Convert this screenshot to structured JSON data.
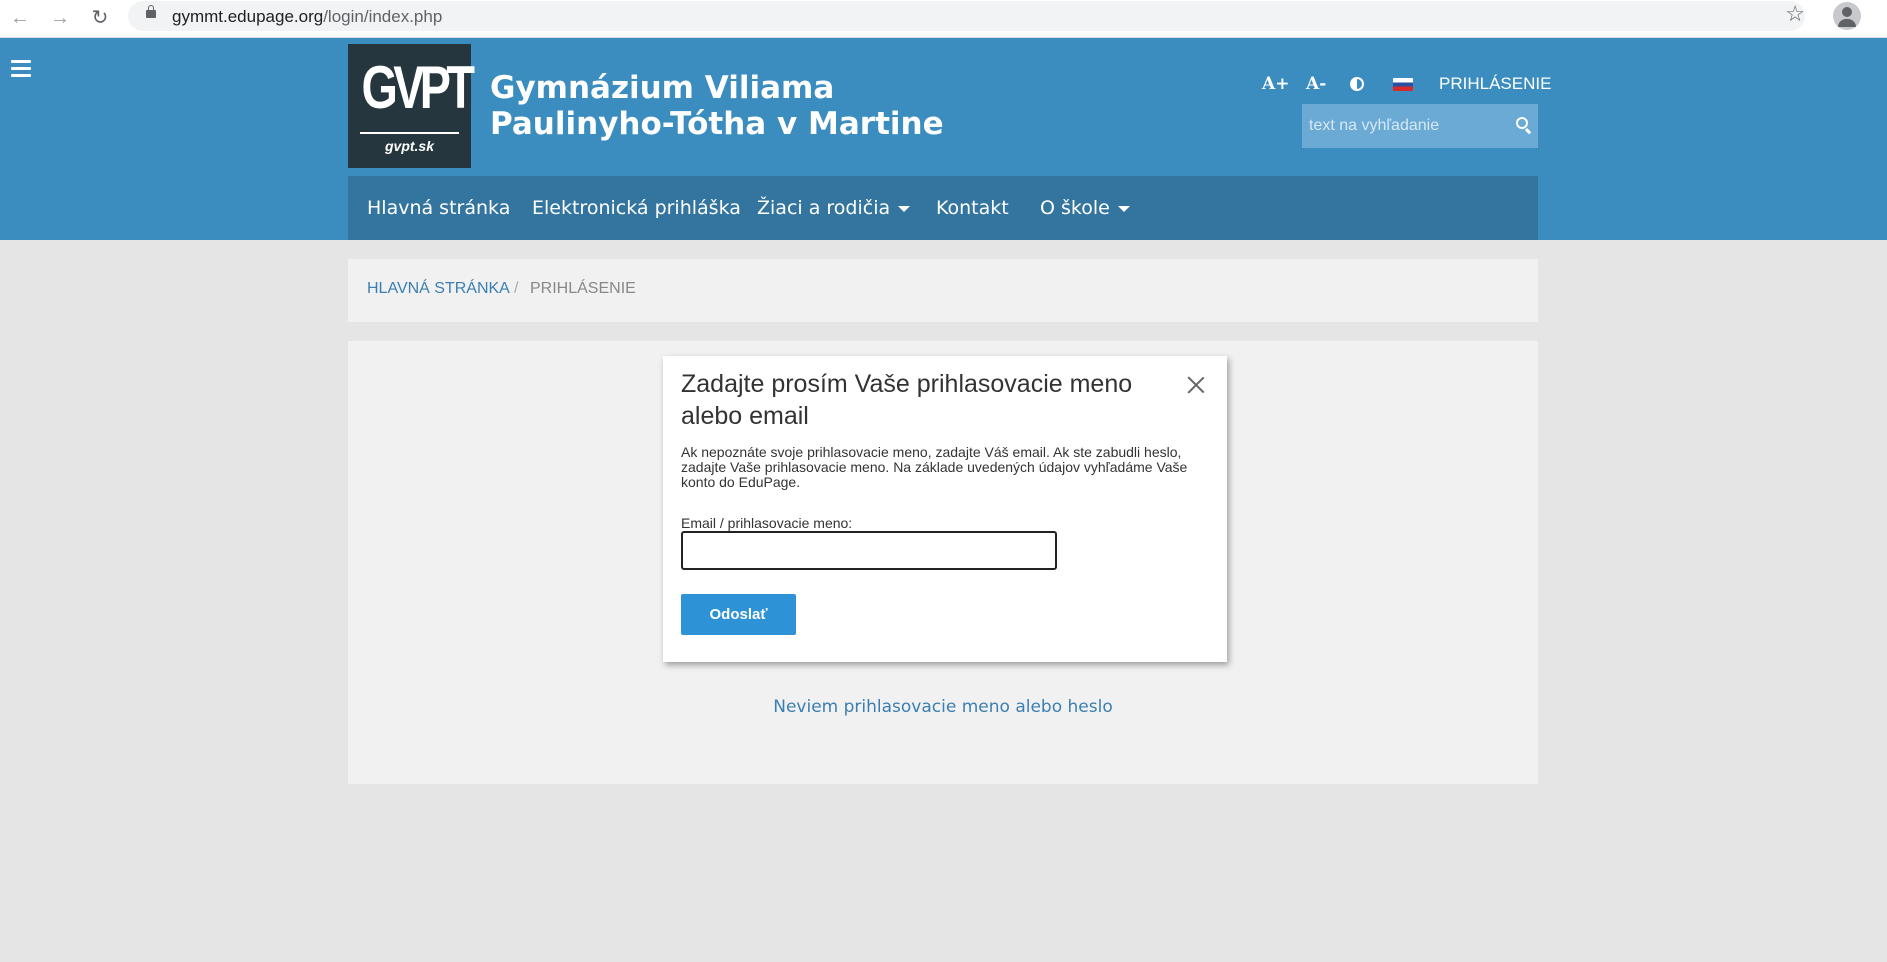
{
  "browser": {
    "url_host": "gymmt.edupage.org",
    "url_path": "/login/index.php"
  },
  "header": {
    "logo_text": "GVPT",
    "logo_subtext": "gvpt.sk",
    "school_name": "Gymnázium Viliama Paulinyho-Tótha v Martine",
    "font_increase_label": "A+",
    "font_decrease_label": "A-",
    "login_label": "PRIHLÁSENIE",
    "search_placeholder": "text na vyhľadanie"
  },
  "nav": {
    "items": [
      {
        "label": "Hlavná stránka",
        "dropdown": false
      },
      {
        "label": "Elektronická prihláška",
        "dropdown": false
      },
      {
        "label": "Žiaci a rodičia",
        "dropdown": true
      },
      {
        "label": "Kontakt",
        "dropdown": false
      },
      {
        "label": "O škole",
        "dropdown": true
      }
    ]
  },
  "breadcrumb": {
    "home": "HLAVNÁ STRÁNKA",
    "separator": "/",
    "current": "PRIHLÁSENIE"
  },
  "dialog": {
    "title": "Zadajte prosím Vaše prihlasovacie meno alebo email",
    "description": "Ak nepoznáte svoje prihlasovacie meno, zadajte Váš email. Ak ste zabudli heslo, zadajte Vaše prihlasovacie meno. Na základe uvedených údajov vyhľadáme Vaše konto do EduPage.",
    "field_label": "Email / prihlasovacie meno:",
    "field_value": "",
    "submit_label": "Odoslať"
  },
  "forgot_link": "Neviem prihlasovacie meno alebo heslo",
  "colors": {
    "header_bg": "#3b8dc0",
    "nav_bg": "#33759e",
    "button_bg": "#2e92d6",
    "link": "#3b7fb2"
  }
}
